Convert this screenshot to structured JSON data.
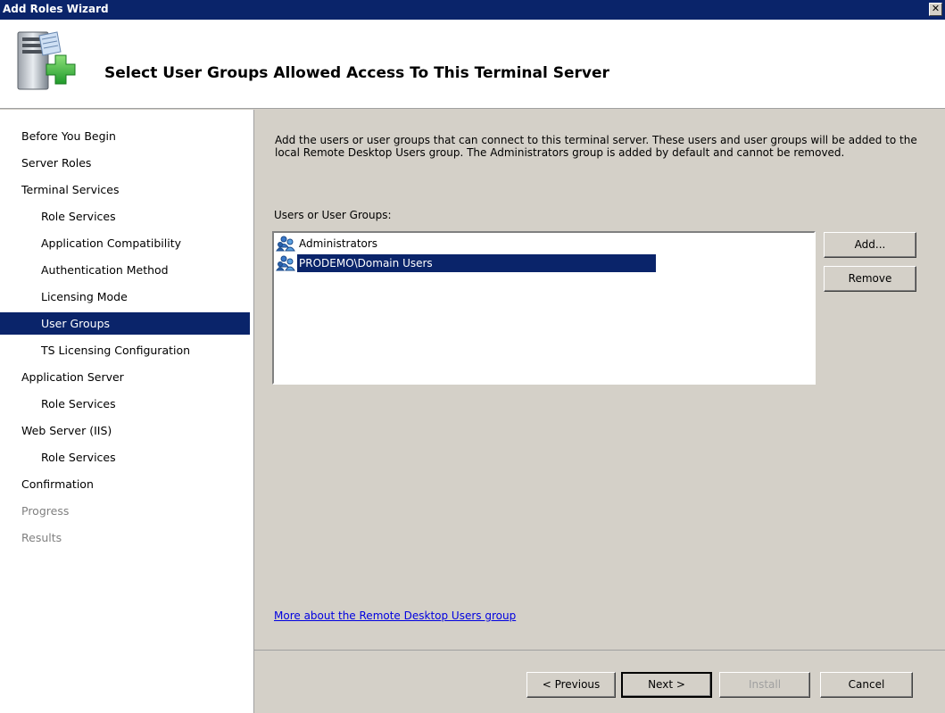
{
  "window": {
    "title": "Add Roles Wizard"
  },
  "header": {
    "heading": "Select User Groups Allowed Access To This Terminal Server"
  },
  "nav": {
    "items": [
      {
        "label": "Before You Begin",
        "level": 1,
        "state": "normal"
      },
      {
        "label": "Server Roles",
        "level": 1,
        "state": "normal"
      },
      {
        "label": "Terminal Services",
        "level": 1,
        "state": "normal"
      },
      {
        "label": "Role Services",
        "level": 2,
        "state": "normal"
      },
      {
        "label": "Application Compatibility",
        "level": 2,
        "state": "normal"
      },
      {
        "label": "Authentication Method",
        "level": 2,
        "state": "normal"
      },
      {
        "label": "Licensing Mode",
        "level": 2,
        "state": "normal"
      },
      {
        "label": "User Groups",
        "level": 2,
        "state": "selected"
      },
      {
        "label": "TS Licensing Configuration",
        "level": 2,
        "state": "normal"
      },
      {
        "label": "Application Server",
        "level": 1,
        "state": "normal"
      },
      {
        "label": "Role Services",
        "level": 2,
        "state": "normal"
      },
      {
        "label": "Web Server (IIS)",
        "level": 1,
        "state": "normal"
      },
      {
        "label": "Role Services",
        "level": 2,
        "state": "normal"
      },
      {
        "label": "Confirmation",
        "level": 1,
        "state": "normal"
      },
      {
        "label": "Progress",
        "level": 1,
        "state": "disabled"
      },
      {
        "label": "Results",
        "level": 1,
        "state": "disabled"
      }
    ]
  },
  "content": {
    "description": "Add the users or user groups that can connect to this terminal server. These users and user groups will be added to the local Remote Desktop Users group. The Administrators group is added by default and cannot be removed.",
    "list_label": "Users or User Groups:",
    "list_items": [
      {
        "label": "Administrators",
        "icon": "user-group-icon",
        "selected": false
      },
      {
        "label": "PRODEMO\\Domain Users",
        "icon": "user-group-icon",
        "selected": true
      }
    ],
    "add_button": "Add...",
    "remove_button": "Remove",
    "help_link": "More about the Remote Desktop Users group"
  },
  "footer": {
    "previous": "< Previous",
    "next": "Next >",
    "install": "Install",
    "cancel": "Cancel"
  },
  "colors": {
    "selection": "#0a246a",
    "dialog_bg": "#d4d0c8",
    "link": "#0000e0"
  }
}
